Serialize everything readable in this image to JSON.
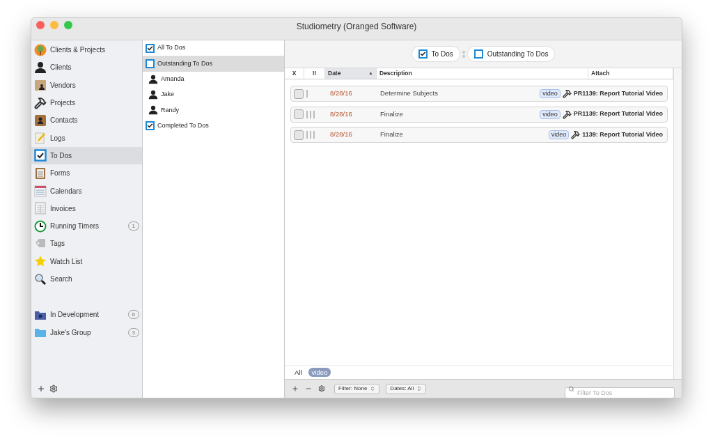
{
  "window": {
    "title": "Studiometry (Oranged Software)"
  },
  "sidebar": {
    "items": [
      {
        "label": "Clients & Projects",
        "selected": false
      },
      {
        "label": "Clients",
        "selected": false
      },
      {
        "label": "Vendors",
        "selected": false
      },
      {
        "label": "Projects",
        "selected": false
      },
      {
        "label": "Contacts",
        "selected": false
      },
      {
        "label": "Logs",
        "selected": false
      },
      {
        "label": "To Dos",
        "selected": true
      },
      {
        "label": "Forms",
        "selected": false
      },
      {
        "label": "Calendars",
        "selected": false
      },
      {
        "label": "Invoices",
        "selected": false
      },
      {
        "label": "Running Timers",
        "selected": false,
        "count": "1"
      },
      {
        "label": "Tags",
        "selected": false
      },
      {
        "label": "Watch List",
        "selected": false
      },
      {
        "label": "Search",
        "selected": false
      }
    ],
    "groups": [
      {
        "label": "In Development",
        "count": "6",
        "selected": false
      },
      {
        "label": "Jake's Group",
        "count": "3",
        "selected": false
      }
    ]
  },
  "filters": {
    "items": [
      {
        "label": "All To Dos",
        "kind": "checkbox",
        "checked": true,
        "selected": false
      },
      {
        "label": "Outstanding To Dos",
        "kind": "checkbox",
        "checked": false,
        "selected": true
      },
      {
        "label": "Amanda",
        "kind": "person",
        "selected": false
      },
      {
        "label": "Jake",
        "kind": "person",
        "selected": false
      },
      {
        "label": "Randy",
        "kind": "person",
        "selected": false
      },
      {
        "label": "Completed To Dos",
        "kind": "checkbox",
        "checked": true,
        "selected": false
      }
    ]
  },
  "breadcrumb": [
    {
      "label": "To Dos",
      "checked": true
    },
    {
      "label": "Outstanding To Dos",
      "checked": false
    }
  ],
  "table": {
    "columns": [
      "X",
      "!!",
      "Date",
      "Description",
      "Attach"
    ],
    "sort_marker": "▲",
    "rows": [
      {
        "done": false,
        "kind": "low",
        "date": "8/28/16",
        "description": "Determine Subjects",
        "tag": "video",
        "project": "PR1139: Report Tutorial Video"
      },
      {
        "done": false,
        "kind": "high",
        "date": "8/28/16",
        "description": "Finalize",
        "tag": "video",
        "project": "PR1139: Report Tutorial Video"
      },
      {
        "done": false,
        "kind": "high",
        "date": "8/28/16",
        "description": "Finalize",
        "tag": "video",
        "project": "1139: Report Tutorial Video"
      }
    ]
  },
  "tag_bar": [
    {
      "label": "All",
      "selected": false
    },
    {
      "label": "video",
      "selected": true
    }
  ],
  "bottom_bar": {
    "filter": "Filter: None",
    "dates": "Dates: All",
    "search": {
      "placeholder": "Filter To Dos"
    }
  }
}
